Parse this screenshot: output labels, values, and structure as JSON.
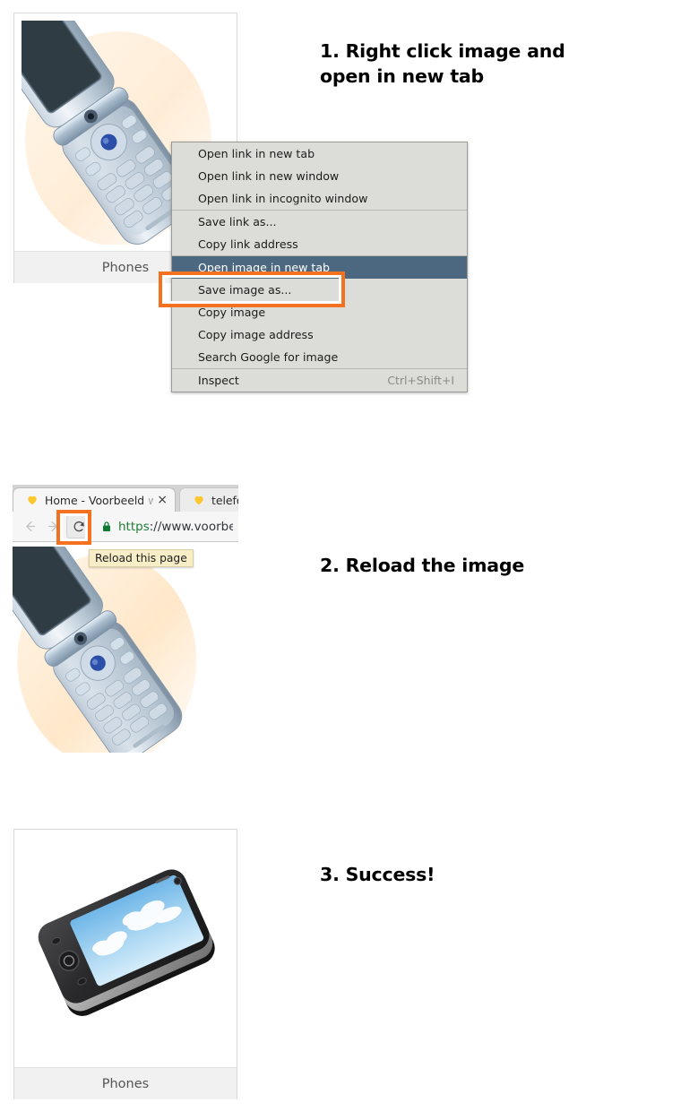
{
  "steps": [
    {
      "id": "step1",
      "text": "1. Right click image and\nopen in new tab"
    },
    {
      "id": "step2",
      "text": "2. Reload the image"
    },
    {
      "id": "step3",
      "text": "3. Success!"
    }
  ],
  "cards": [
    {
      "caption": "Phones",
      "image": "flip-phone-photo"
    },
    {
      "caption": "Phones",
      "image": "smartphone-photo"
    }
  ],
  "context_menu": {
    "groups": [
      {
        "items": [
          {
            "label": "Open link in new tab",
            "highlighted": false,
            "shortcut": ""
          },
          {
            "label": "Open link in new window",
            "highlighted": false,
            "shortcut": ""
          },
          {
            "label": "Open link in incognito window",
            "highlighted": false,
            "shortcut": ""
          }
        ]
      },
      {
        "items": [
          {
            "label": "Save link as...",
            "highlighted": false,
            "shortcut": ""
          },
          {
            "label": "Copy link address",
            "highlighted": false,
            "shortcut": ""
          }
        ]
      },
      {
        "items": [
          {
            "label": "Open image in new tab",
            "highlighted": true,
            "shortcut": ""
          },
          {
            "label": "Save image as...",
            "highlighted": false,
            "shortcut": ""
          },
          {
            "label": "Copy image",
            "highlighted": false,
            "shortcut": ""
          },
          {
            "label": "Copy image address",
            "highlighted": false,
            "shortcut": ""
          },
          {
            "label": "Search Google for image",
            "highlighted": false,
            "shortcut": ""
          }
        ]
      },
      {
        "items": [
          {
            "label": "Inspect",
            "highlighted": false,
            "shortcut": "Ctrl+Shift+I"
          }
        ]
      }
    ],
    "highlight_color": "#f4711f",
    "highlight_row_color": "#4c6881",
    "menu_background": "#dcdcd8"
  },
  "browser": {
    "tabs": [
      {
        "title_strong": "Home - Voorbeeld ",
        "title_faded": "we",
        "favicon": "heart-icon",
        "active": true,
        "close": "×"
      },
      {
        "title_strong": "telefoo",
        "title_faded": "",
        "favicon": "heart-icon",
        "active": false,
        "close": ""
      }
    ],
    "nav": {
      "back_icon": "arrow-left-icon",
      "forward_icon": "arrow-right-icon",
      "reload_icon": "reload-icon"
    },
    "omnibox": {
      "lock_icon": "lock-icon",
      "url_scheme": "https",
      "url_rest": "://www.voorbeeld"
    },
    "tooltip": "Reload this page"
  }
}
